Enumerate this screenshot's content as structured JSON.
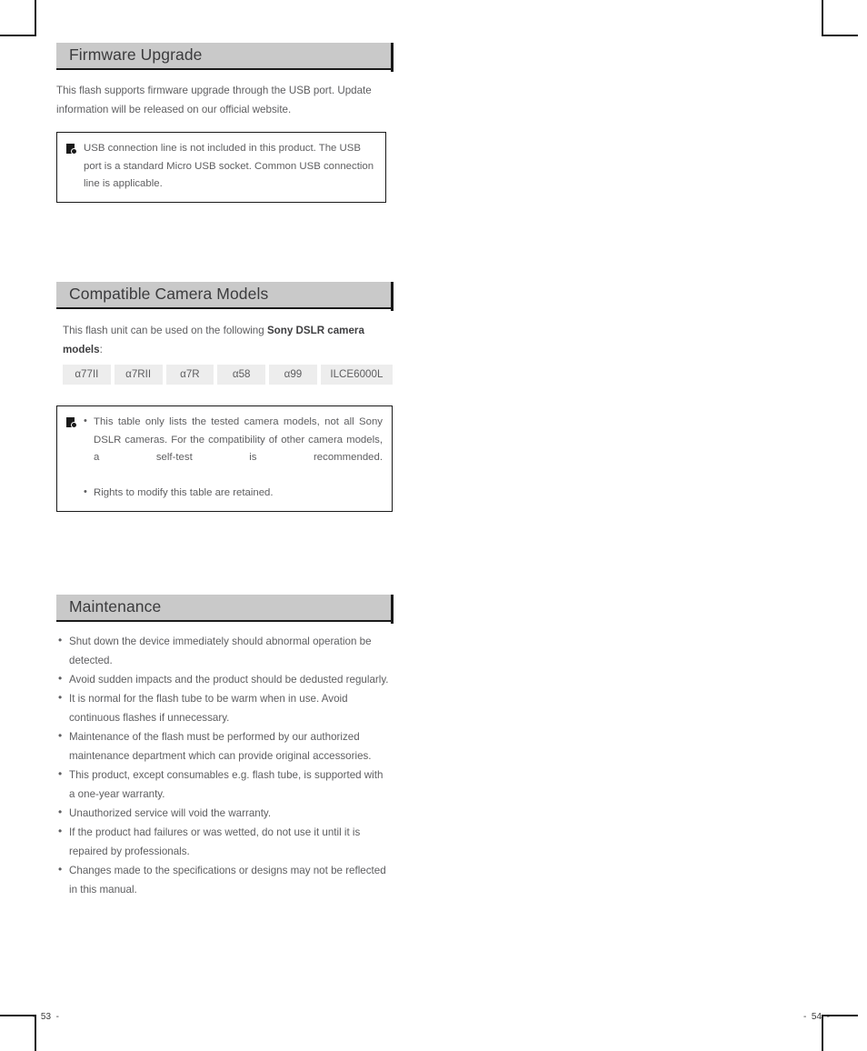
{
  "document": {
    "page_numbers": {
      "left": "-  53  -",
      "right": "-  54  -"
    }
  },
  "sections": {
    "firmware": {
      "heading": "Firmware Upgrade",
      "paragraph": "This flash supports firmware upgrade through the USB port. Update information will be released on our official website.",
      "note": {
        "icon": "note-icon",
        "text": "USB connection line is not included in this product. The USB port is a standard Micro USB socket. Common USB connection line is applicable."
      }
    },
    "compatible_models": {
      "heading": "Compatible Camera Models",
      "intro_prefix": "This flash unit can be used on the following ",
      "intro_bold": "Sony DSLR camera models",
      "intro_suffix": ":",
      "chips": [
        "α77II",
        "α7RII",
        "α7R",
        "α58",
        "α99",
        "ILCE6000L"
      ],
      "note": {
        "icon": "note-icon",
        "bullets": [
          "This table only lists the tested camera models, not all Sony DSLR cameras. For the compatibility of other camera models, a self-test is recommended.",
          "Rights to modify this table are retained."
        ]
      }
    },
    "maintenance": {
      "heading": "Maintenance",
      "bullets": [
        "Shut down the device immediately should abnormal operation be detected.",
        "Avoid sudden impacts and the product should be dedusted regularly.",
        "It is normal for the flash tube to be warm when in use. Avoid continuous flashes if unnecessary.",
        "Maintenance of the flash must be performed by our authorized maintenance department which can provide original accessories.",
        "This product, except consumables e.g. flash tube, is supported with a one-year warranty.",
        "Unauthorized service will void the warranty.",
        "If the product had failures or was wetted, do not use it until it is repaired by professionals.",
        "Changes made to the specifications or designs may not be reflected in this manual."
      ]
    }
  },
  "colors": {
    "header_bar": "#c9c9c9",
    "header_edge": "#1a1a1a",
    "chip_bg": "#ededed",
    "body_text": "#5e5e60"
  }
}
